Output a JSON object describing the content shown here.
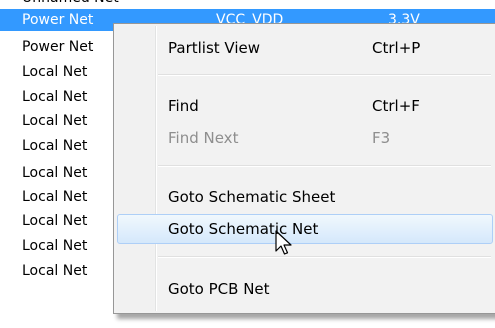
{
  "net_list": {
    "cut_row": {
      "name": "Unnamed Net"
    },
    "rows": [
      {
        "name": "Power Net",
        "voltname": "VCC_VDD",
        "voltage": "3.3V",
        "selected": true
      },
      {
        "name": "Power Net"
      },
      {
        "name": "Local Net"
      },
      {
        "name": "Local Net"
      },
      {
        "name": "Local Net"
      },
      {
        "name": "Local Net"
      },
      {
        "name": "Local Net"
      },
      {
        "name": "Local Net"
      },
      {
        "name": "Local Net"
      },
      {
        "name": "Local Net"
      },
      {
        "name": "Local Net"
      }
    ]
  },
  "context_menu": {
    "items": [
      {
        "label": "Partlist View",
        "shortcut": "Ctrl+P"
      },
      {
        "label": "Find",
        "shortcut": "Ctrl+F"
      },
      {
        "label": "Find Next",
        "shortcut": "F3",
        "disabled": true
      },
      {
        "label": "Goto Schematic Sheet"
      },
      {
        "label": "Goto Schematic Net",
        "highlighted": true
      },
      {
        "label": "Goto PCB Net"
      }
    ]
  },
  "colors": {
    "selection_bg": "#3399ff",
    "menu_bg": "#f2f2f2",
    "highlight_border": "#aecff7",
    "disabled_text": "#8e8e8e"
  },
  "icons": {
    "pointer": "arrow-cursor-icon"
  }
}
